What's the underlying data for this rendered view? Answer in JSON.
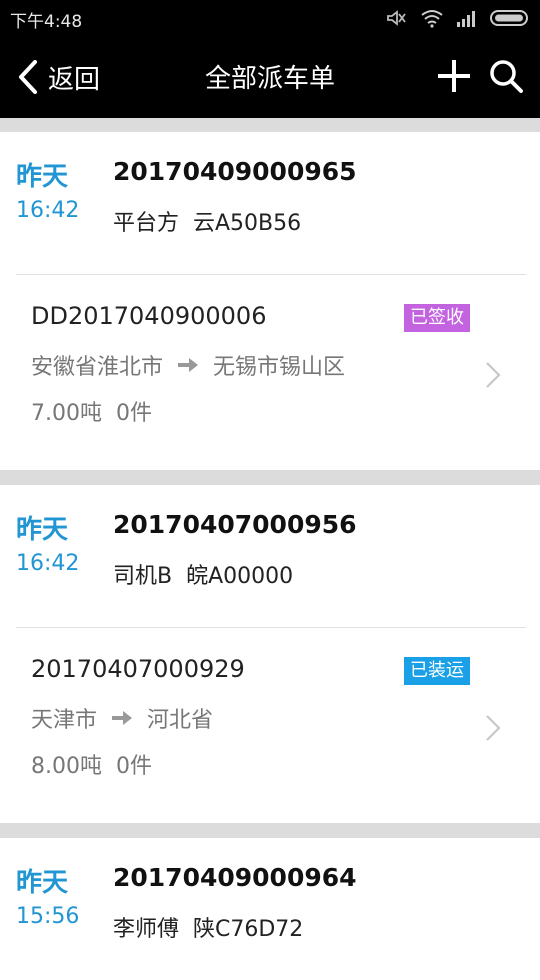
{
  "status_bar": {
    "time": "下午4:48"
  },
  "nav": {
    "back_label": "返回",
    "title": "全部派车单"
  },
  "cards": [
    {
      "day": "昨天",
      "time": "16:42",
      "dispatch_no": "20170409000965",
      "carrier_plate": "平台方  云A50B56",
      "order": {
        "order_no": "DD2017040900006",
        "status": "已签收",
        "from": "安徽省淮北市",
        "to": "无锡市锡山区",
        "stats": "7.00吨  0件"
      }
    },
    {
      "day": "昨天",
      "time": "16:42",
      "dispatch_no": "20170407000956",
      "carrier_plate": "司机B  皖A00000",
      "order": {
        "order_no": "20170407000929",
        "status": "已装运",
        "from": "天津市",
        "to": "河北省",
        "stats": "8.00吨  0件"
      }
    },
    {
      "day": "昨天",
      "time": "15:56",
      "dispatch_no": "20170409000964",
      "carrier_plate": "李师傅  陕C76D72"
    }
  ],
  "colors": {
    "accent_blue": "#2196d3",
    "badge_signed": "#c463e0",
    "badge_shipped": "#1aa0e6"
  },
  "icons": [
    "mute-icon",
    "wifi-icon",
    "signal-icon",
    "battery-icon",
    "back-arrow-icon",
    "add-icon",
    "search-icon",
    "route-arrow-icon",
    "chevron-right-icon"
  ]
}
